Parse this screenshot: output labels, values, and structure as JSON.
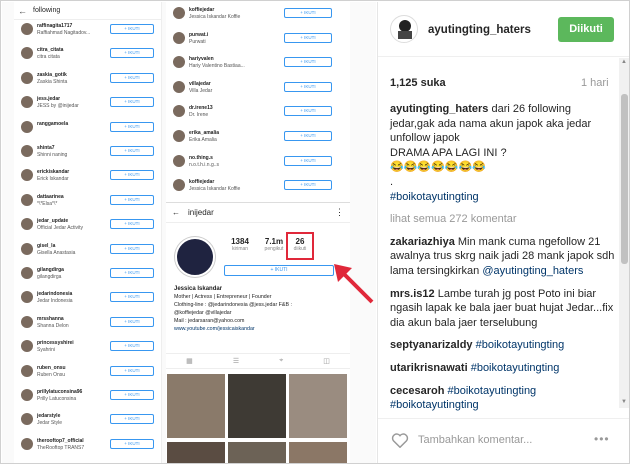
{
  "screenshot": {
    "following_header": "following",
    "follow_button": "+ IKUTI",
    "left_list": [
      {
        "user": "raffinagita1717",
        "name": "Raffiahmad Nagitadov..."
      },
      {
        "user": "citra_citata",
        "name": "citra citata"
      },
      {
        "user": "zaskia_gotik",
        "name": "Zaskia Shinta"
      },
      {
        "user": "jess.jedar",
        "name": "JESS by @inijedar"
      },
      {
        "user": "ranggamoela",
        "name": ""
      },
      {
        "user": "shinta7",
        "name": "Shinni naning"
      },
      {
        "user": "erickiskandar",
        "name": "Erick Iskandar"
      },
      {
        "user": "dattaarinea",
        "name": "*\\*Elsa*\\*"
      },
      {
        "user": "jedar_update",
        "name": "Official Jedar Activity"
      },
      {
        "user": "gisel_la",
        "name": "Gisella Anastasia"
      },
      {
        "user": "gilangdirga",
        "name": "gilangdirga"
      },
      {
        "user": "jedarindonesia",
        "name": "Jedar Indonesia"
      },
      {
        "user": "mrsshanna",
        "name": "Shanna Delon"
      },
      {
        "user": "princessyshirei",
        "name": "Syahrini"
      },
      {
        "user": "ruben_onsu",
        "name": "Ruben Onsu"
      },
      {
        "user": "prillylatuconsina96",
        "name": "Prilly Latuconsina"
      },
      {
        "user": "jedarstyle",
        "name": "Jedar Style"
      },
      {
        "user": "therooftop7_official",
        "name": "TheRooftop TRANS7"
      }
    ],
    "middle_list": [
      {
        "user": "koffiejedar",
        "name": "Jessica Iskandar Koffie"
      },
      {
        "user": "purwat.i",
        "name": "Purwati"
      },
      {
        "user": "hariyvalen",
        "name": "Hariy Valentino Bastiaa..."
      },
      {
        "user": "villajedar",
        "name": "Villa Jedar"
      },
      {
        "user": "dr.irene13",
        "name": "Dr. Irene"
      },
      {
        "user": "erika_amalia",
        "name": "Erika Amalia"
      },
      {
        "user": "no.thing.s",
        "name": "n.o.t.h.i.n.g..s"
      },
      {
        "user": "koffiejedar",
        "name": "Jessica Iskandar Koffie"
      }
    ],
    "profile": {
      "handle": "inijedar",
      "posts_value": "1384",
      "posts_label": "kiriman",
      "followers_value": "7.1m",
      "followers_label": "pengikut",
      "following_value": "26",
      "following_label": "diikuti",
      "follow_button": "+ IKUTI",
      "display_name": "Jessica Iskandar",
      "bio_1": "Mother | Actress | Entrepreneur | Founder",
      "bio_2": "Clothing-line : @jedarindonesia @jess.jedar F&B :",
      "bio_3": "@koffiejedar @villajedar",
      "bio_4": "Mail : jedarsaran@yahoo.com",
      "link": "www.youtube.com/jessicaiskandar"
    }
  },
  "post": {
    "username": "ayutingting_haters",
    "follow_label": "Diikuti",
    "likes": "1,125 suka",
    "time": "1 hari",
    "caption_user": "ayutingting_haters",
    "caption_text": " dari 26 following jedar,gak ada nama akun japok aka jedar unfollow japok",
    "caption_line2": "DRAMA APA LAGI INI ?",
    "caption_emoji": "😂😂😂😂😂😂😂",
    "caption_dot": ".",
    "caption_tag": "#boikotayutingting",
    "view_all": "lihat semua 272 komentar",
    "comments": [
      {
        "user": "zakariazhiya",
        "text": " Min mank cuma ngefollow 21 awalnya trus skrg naik jadi 28 mank japok sdh lama tersingkirkan ",
        "tag": "@ayutingting_haters"
      },
      {
        "user": "mrs.is12",
        "text": " Lambe turah jg post Poto ini biar ngasih lapak ke bala jaer buat hujat Jedar...fix dia akun bala jaer terselubung",
        "tag": ""
      },
      {
        "user": "septyanarizaldy",
        "text": " ",
        "tag": "#boikotayutingting"
      },
      {
        "user": "utarikrisnawati",
        "text": " ",
        "tag": "#boikotayutingting"
      },
      {
        "user": "cecesaroh",
        "text": " ",
        "tag": "#boikotayutingting #boikotayutingting"
      }
    ],
    "comment_placeholder": "Tambahkan komentar...",
    "more_label": "•••"
  },
  "colors": {
    "follow_green": "#5cb85c",
    "ig_blue": "#3897f0",
    "highlight_red": "#e0283a",
    "hashtag": "#003569"
  },
  "icons": [
    "back-arrow-icon",
    "more-options-icon",
    "heart-icon",
    "grid-icon",
    "list-icon",
    "location-icon",
    "tagged-icon",
    "red-arrow-icon"
  ]
}
